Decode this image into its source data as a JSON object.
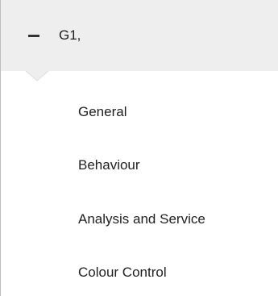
{
  "group": {
    "title": "G1,",
    "expanded": true
  },
  "menu": {
    "items": [
      {
        "label": "General"
      },
      {
        "label": "Behaviour"
      },
      {
        "label": "Analysis and Service"
      },
      {
        "label": "Colour Control"
      }
    ]
  },
  "colors": {
    "header_background": "#eeeeee",
    "text": "#1f1f1f",
    "border": "#bdbdbd"
  }
}
